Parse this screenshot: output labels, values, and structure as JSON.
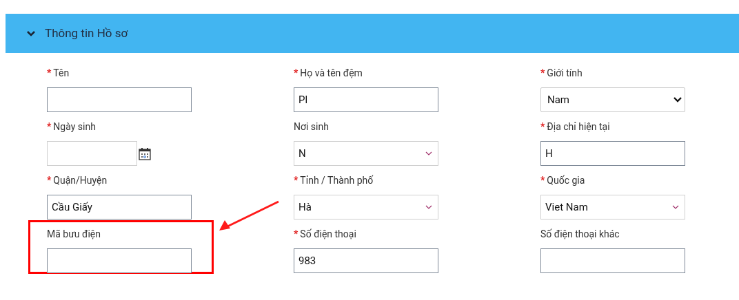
{
  "section": {
    "title": "Thông tin Hồ sơ",
    "expanded": true
  },
  "fields": [
    {
      "mark": "*",
      "label": "Tên",
      "kind": "text"
    },
    {
      "mark": "*",
      "label": "Họ và tên đệm",
      "kind": "text",
      "value": "Pl"
    },
    {
      "mark": "*",
      "label": "Giới tính",
      "kind": "select",
      "value": "Nam"
    },
    {
      "mark": "*",
      "label": "Ngày sinh",
      "kind": "date"
    },
    {
      "label": "Nơi sinh",
      "kind": "combo",
      "value": "N"
    },
    {
      "mark": "*",
      "label": "Địa chỉ hiện tại",
      "kind": "text",
      "value": "H"
    },
    {
      "mark": "*",
      "label": "Quận/Huyện",
      "kind": "text",
      "value": "Cầu Giấy"
    },
    {
      "mark": "*",
      "label": "Tỉnh / Thành phố",
      "kind": "combo",
      "value": "Hà"
    },
    {
      "mark": "*",
      "label": "Quốc gia",
      "kind": "combo",
      "value": "Viet Nam"
    },
    {
      "label": "Mã bưu điện",
      "kind": "text",
      "highlighted": true
    },
    {
      "mark": "*",
      "label": "Số điện thoại",
      "kind": "text",
      "value": "983"
    },
    {
      "label": "Số điện thoại khác",
      "kind": "text"
    }
  ]
}
